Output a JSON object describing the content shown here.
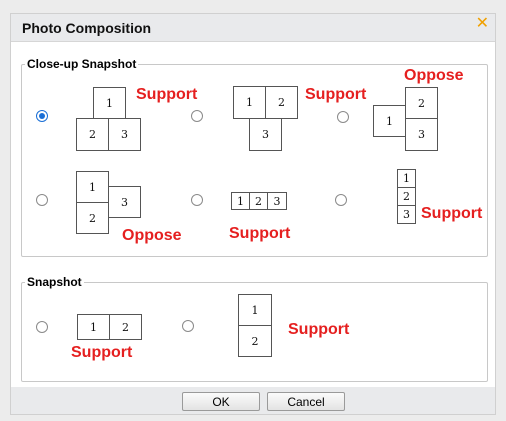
{
  "dialog": {
    "title": "Photo Composition",
    "close_glyph": "✕"
  },
  "closeup": {
    "legend": "Close-up Snapshot",
    "layouts": [
      {
        "cells": [
          "1",
          "2",
          "3"
        ],
        "label": "Support",
        "selected": true
      },
      {
        "cells": [
          "1",
          "2",
          "3"
        ],
        "label": "Support",
        "selected": false
      },
      {
        "cells": [
          "1",
          "2",
          "3"
        ],
        "label": "Oppose",
        "selected": false
      },
      {
        "cells": [
          "1",
          "2",
          "3"
        ],
        "label": "Oppose",
        "selected": false
      },
      {
        "cells": [
          "1",
          "2",
          "3"
        ],
        "label": "Support",
        "selected": false
      },
      {
        "cells": [
          "1",
          "2",
          "3"
        ],
        "label": "Support",
        "selected": false
      }
    ]
  },
  "snapshot": {
    "legend": "Snapshot",
    "layouts": [
      {
        "cells": [
          "1",
          "2"
        ],
        "label": "Support",
        "selected": false
      },
      {
        "cells": [
          "1",
          "2"
        ],
        "label": "Support",
        "selected": false
      }
    ]
  },
  "buttons": {
    "ok": "OK",
    "cancel": "Cancel"
  },
  "colors": {
    "annotation": "#e51f1f",
    "radio_selected": "#1a6fd6",
    "close_icon": "#f0a000"
  }
}
